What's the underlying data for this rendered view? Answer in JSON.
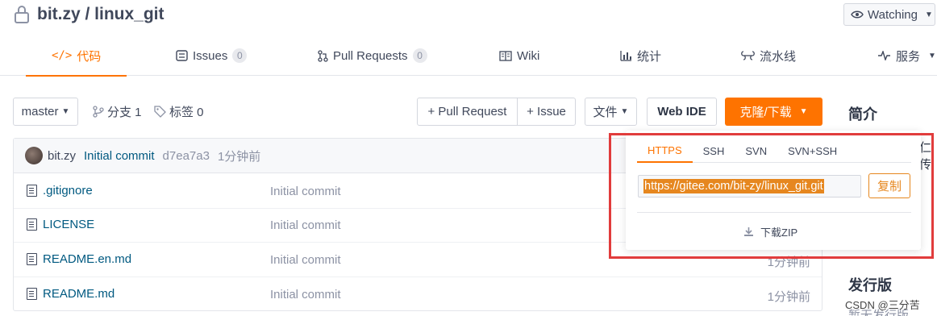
{
  "repo": {
    "title": "bit.zy / linux_git",
    "icon": "lock-icon"
  },
  "watch": {
    "label": "Watching"
  },
  "tabs": [
    {
      "label": "代码",
      "icon": "code-icon",
      "active": true
    },
    {
      "label": "Issues",
      "count": "0",
      "icon": "issues-icon"
    },
    {
      "label": "Pull Requests",
      "count": "0",
      "icon": "pull-request-icon"
    },
    {
      "label": "Wiki",
      "icon": "wiki-icon"
    },
    {
      "label": "统计",
      "icon": "stats-icon"
    },
    {
      "label": "流水线",
      "icon": "pipeline-icon"
    },
    {
      "label": "服务",
      "icon": "service-icon"
    }
  ],
  "toolbar": {
    "branch": "master",
    "branches": "分支 1",
    "tags": "标签 0",
    "pull_request": "+ Pull Request",
    "issue": "+ Issue",
    "files": "文件",
    "web_ide": "Web IDE",
    "clone": "克隆/下载"
  },
  "commit": {
    "author": "bit.zy",
    "message": "Initial commit",
    "hash": "d7ea7a3",
    "time": "1分钟前"
  },
  "files": [
    {
      "name": ".gitignore",
      "message": "Initial commit",
      "time": ""
    },
    {
      "name": "LICENSE",
      "message": "Initial commit",
      "time": ""
    },
    {
      "name": "README.en.md",
      "message": "Initial commit",
      "time": "1分钟前"
    },
    {
      "name": "README.md",
      "message": "Initial commit",
      "time": "1分钟前"
    }
  ],
  "clone_popover": {
    "tabs": [
      "HTTPS",
      "SSH",
      "SVN",
      "SVN+SSH"
    ],
    "active_tab": "HTTPS",
    "url": "https://gitee.com/bit-zy/linux_git.git",
    "copy_label": "复制",
    "download_zip": "下载ZIP"
  },
  "sidebar": {
    "intro_title": "简介",
    "clipped_text": "仁传",
    "release_title": "发行版",
    "release_text": "暂无发行版"
  },
  "watermark": "CSDN @三分苦",
  "colors": {
    "accent": "#fe7300",
    "highlight": "#e13c3c"
  }
}
